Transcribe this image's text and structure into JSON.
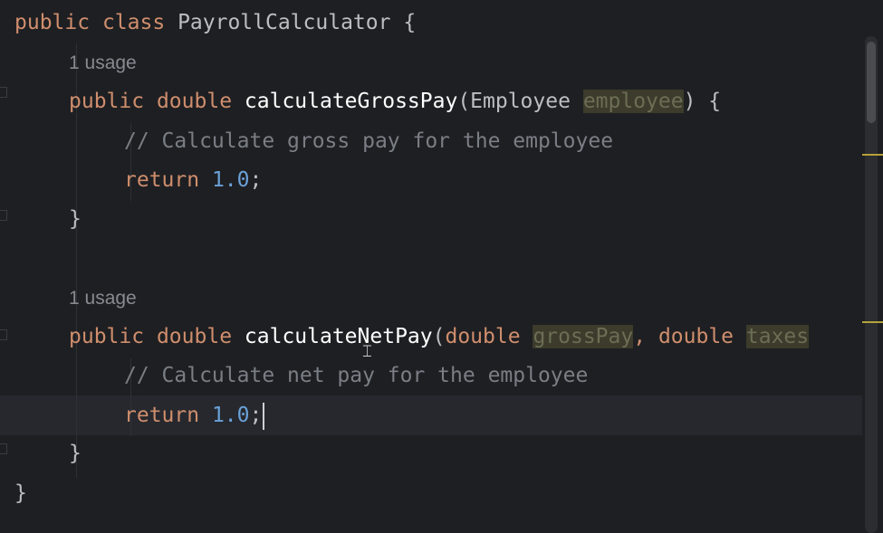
{
  "editor": {
    "language": "Java",
    "lines": {
      "class_decl": {
        "kw1": "public",
        "kw2": "class",
        "name": "PayrollCalculator",
        "brace": "{"
      },
      "usage1": "1 usage",
      "method1": {
        "kw1": "public",
        "kw2": "double",
        "name": "calculateGrossPay",
        "open": "(",
        "param_type": "Employee",
        "param_name": "employee",
        "close": ") {"
      },
      "comment1": "// Calculate gross pay for the employee",
      "return1": {
        "kw": "return",
        "value": "1.0",
        "semi": ";"
      },
      "close1": "}",
      "usage2": "1 usage",
      "method2": {
        "kw1": "public",
        "kw2": "double",
        "name": "calculateNetPay",
        "open": "(",
        "param1_type": "double",
        "param1_name": "grossPay",
        "comma": ",",
        "param2_type": "double",
        "param2_name": "taxes"
      },
      "comment2": "// Calculate net pay for the employee",
      "return2": {
        "kw": "return",
        "value": "1.0",
        "semi": ";"
      },
      "close2": "}",
      "class_close": "}"
    }
  },
  "colors": {
    "background": "#1e1f22",
    "keyword": "#cf8e6d",
    "method_declaration": "#ffffff",
    "number": "#6aa1d8",
    "comment": "#7a7e85",
    "default_text": "#bcbec4",
    "unused_param_highlight": "#3c3b2c"
  },
  "icons": {
    "text_cursor": "i-beam-cursor-icon"
  }
}
